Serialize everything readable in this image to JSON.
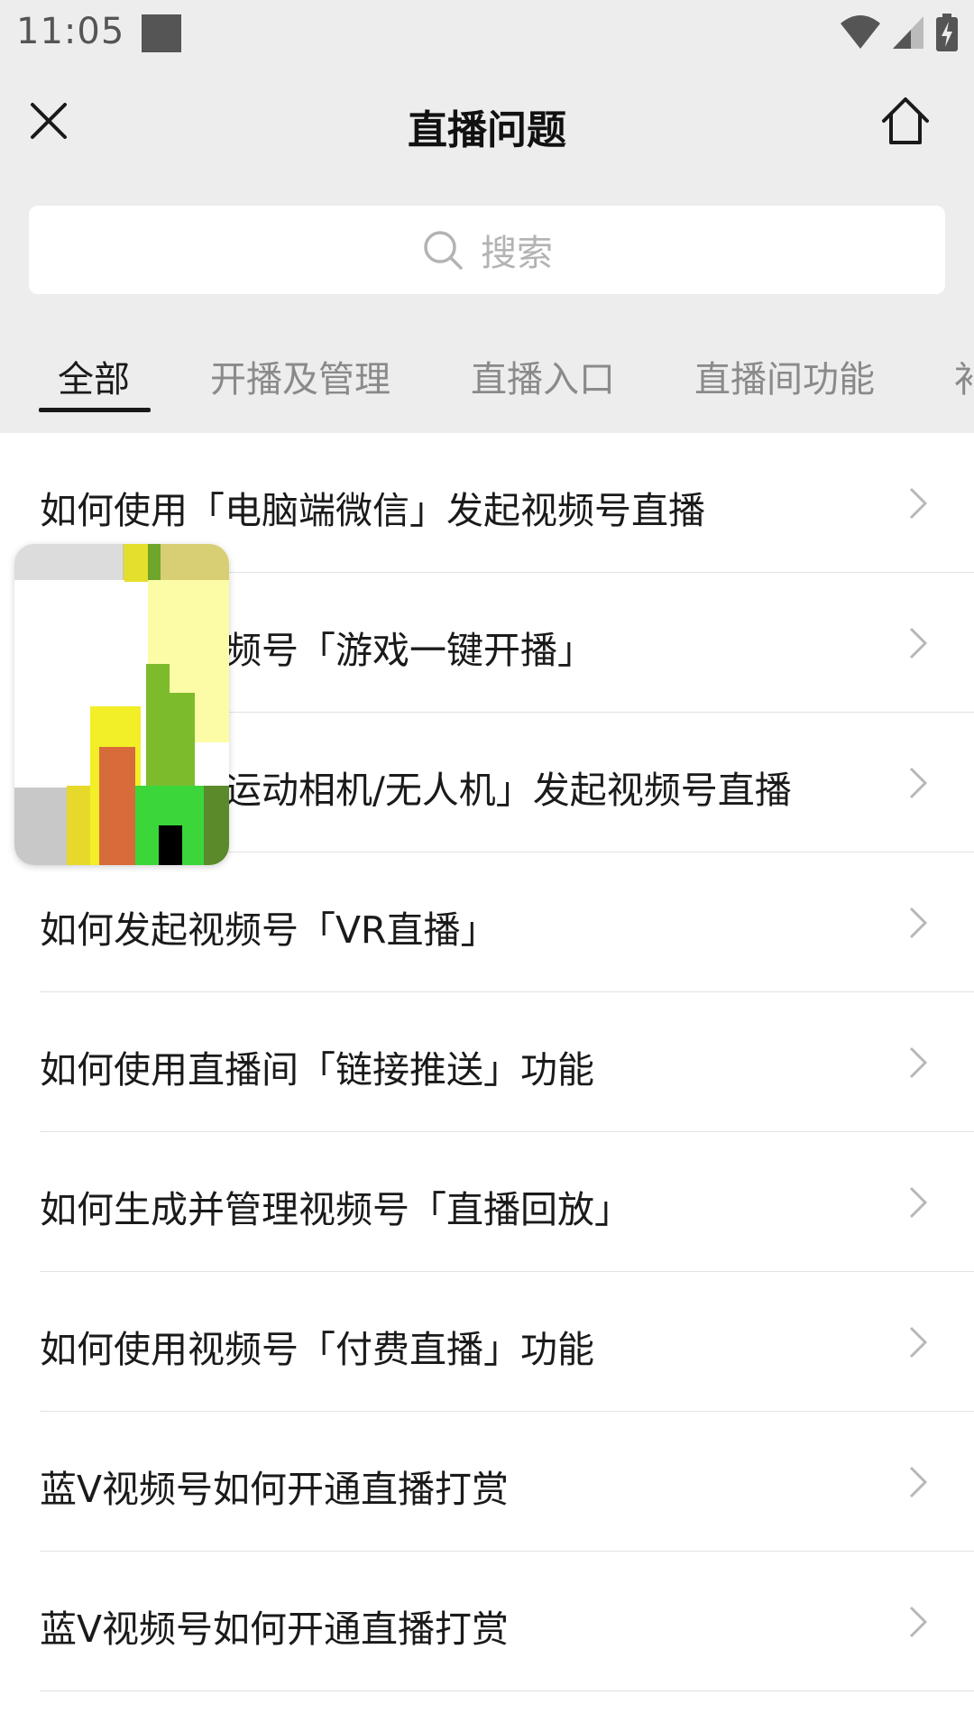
{
  "status_bar": {
    "time": "11:05"
  },
  "nav": {
    "title": "直播问题"
  },
  "search": {
    "placeholder": "搜索"
  },
  "tabs": [
    {
      "label": "全部",
      "active": true
    },
    {
      "label": "开播及管理",
      "active": false
    },
    {
      "label": "直播入口",
      "active": false
    },
    {
      "label": "直播间功能",
      "active": false
    },
    {
      "label": "补",
      "active": false
    }
  ],
  "items": [
    {
      "label": "如何使用「电脑端微信」发起视频号直播"
    },
    {
      "label": "如何使用视频号「游戏一键开播」"
    },
    {
      "label": "如何使用「运动相机/无人机」发起视频号直播"
    },
    {
      "label": "如何发起视频号「VR直播」"
    },
    {
      "label": "如何使用直播间「链接推送」功能"
    },
    {
      "label": "如何生成并管理视频号「直播回放」"
    },
    {
      "label": "如何使用视频号「付费直播」功能"
    },
    {
      "label": "蓝V视频号如何开通直播打赏"
    },
    {
      "label": "蓝V视频号如何开通直播打赏"
    }
  ],
  "colors": {
    "background": "#ededed",
    "text": "#1a1a1a",
    "tab_inactive": "#8a8a8a",
    "divider": "#e2e2e2"
  }
}
